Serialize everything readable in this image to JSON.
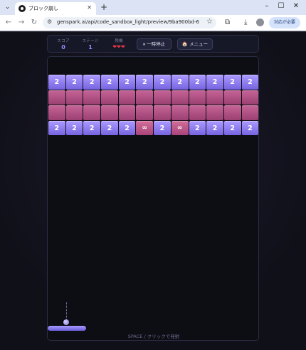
{
  "browser": {
    "tab_title": "ブロック崩し",
    "tab_close": "✕",
    "new_tab": "+",
    "url": "genspark.ai/api/code_sandbox_light/preview/9ba900bd-60df-42e...",
    "request_pill": "対応が必要",
    "icons": [
      "tab-search-icon",
      "back-icon",
      "forward-icon",
      "reload-icon",
      "site-info-icon",
      "bookmark-star-icon",
      "extensions-icon",
      "download-icon",
      "profile-icon",
      "more-icon",
      "minimize-icon",
      "maximize-icon",
      "close-window-icon"
    ]
  },
  "hud": {
    "score_label": "スコア",
    "score_value": "0",
    "stage_label": "ステージ",
    "stage_value": "1",
    "lives_label": "残機",
    "lives_value": 3,
    "lives_display": "❤❤❤",
    "pause_label": "⏸ 一時停止",
    "menu_label": "🏠 メニュー"
  },
  "bricks": [
    [
      "2",
      "2",
      "2",
      "2",
      "2",
      "2",
      "2",
      "2",
      "2",
      "2",
      "2",
      "2"
    ],
    [
      "",
      "",
      "",
      "",
      "",
      "",
      "",
      "",
      "",
      "",
      "",
      ""
    ],
    [
      "",
      "",
      "",
      "",
      "",
      "",
      "",
      "",
      "",
      "",
      "",
      ""
    ],
    [
      "2",
      "2",
      "2",
      "2",
      "2",
      "∞",
      "2",
      "∞",
      "2",
      "2",
      "2",
      "2"
    ]
  ],
  "brick_types": [
    [
      "two",
      "two",
      "two",
      "two",
      "two",
      "two",
      "two",
      "two",
      "two",
      "two",
      "two",
      "two"
    ],
    [
      "pink",
      "pink",
      "pink",
      "pink",
      "pink",
      "pink",
      "pink",
      "pink",
      "pink",
      "pink",
      "pink",
      "pink"
    ],
    [
      "pink",
      "pink",
      "pink",
      "pink",
      "pink",
      "pink",
      "pink",
      "pink",
      "pink",
      "pink",
      "pink",
      "pink"
    ],
    [
      "two",
      "two",
      "two",
      "two",
      "two",
      "inf",
      "two",
      "inf",
      "two",
      "two",
      "two",
      "two"
    ]
  ],
  "hint": "SPACE / クリックで発射",
  "colors": {
    "accent": "#8e8cff",
    "brick_purple": "#8f7ff2",
    "brick_pink": "#b4517f",
    "heart": "#e2354b",
    "background": "#101019"
  }
}
